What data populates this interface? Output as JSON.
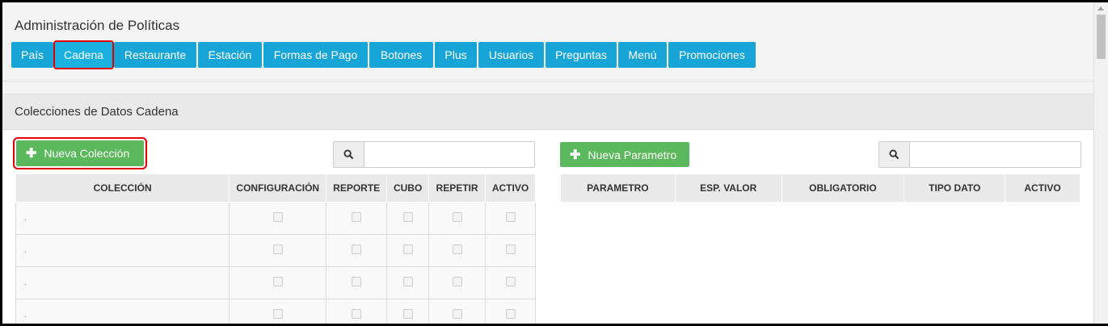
{
  "header": {
    "title": "Administración de Políticas",
    "tabs": [
      {
        "label": "País",
        "width": 52
      },
      {
        "label": "Cadena",
        "width": 71
      },
      {
        "label": "Restaurante",
        "width": 102
      },
      {
        "label": "Estación",
        "width": 79
      },
      {
        "label": "Formas de Pago",
        "width": 129
      },
      {
        "label": "Botones",
        "width": 79
      },
      {
        "label": "Plus",
        "width": 52
      },
      {
        "label": "Usuarios",
        "width": 81
      },
      {
        "label": "Preguntas",
        "width": 88
      },
      {
        "label": "Menú",
        "width": 60
      },
      {
        "label": "Promociones",
        "width": 108
      }
    ],
    "active_tab": "Cadena"
  },
  "section": {
    "title": "Colecciones de Datos Cadena"
  },
  "left": {
    "new_button": "Nueva Colección",
    "search_placeholder": "",
    "columns": [
      "COLECCIÓN",
      "CONFIGURACIÓN",
      "REPORTE",
      "CUBO",
      "REPETIR",
      "ACTIVO"
    ],
    "rows": [
      {
        "name": "."
      },
      {
        "name": "."
      },
      {
        "name": "."
      },
      {
        "name": "."
      }
    ]
  },
  "right": {
    "new_button": "Nueva Parametro",
    "search_placeholder": "",
    "columns": [
      "PARAMETRO",
      "ESP. VALOR",
      "OBLIGATORIO",
      "TIPO DATO",
      "ACTIVO"
    ]
  },
  "colors": {
    "tab": "#17a4d6",
    "green": "#5cb85c",
    "highlight": "#e00000"
  }
}
